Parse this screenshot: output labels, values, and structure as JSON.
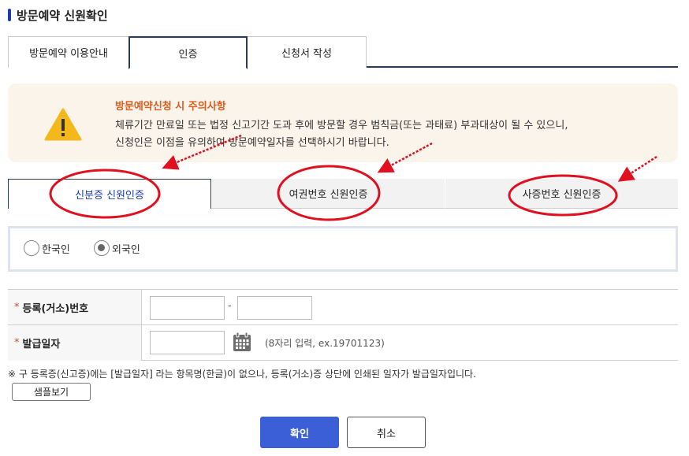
{
  "page": {
    "title": "방문예약 신원확인"
  },
  "tabs": [
    {
      "label": "방문예약 이용안내"
    },
    {
      "label": "인증"
    },
    {
      "label": "신청서 작성"
    }
  ],
  "notice": {
    "title": "방문예약신청 시 주의사항",
    "line1": "체류기간 만료일 또는 법정 신고기간 도과 후에 방문할 경우 범칙금(또는 과태료) 부과대상이 될 수 있으니,",
    "line2": "신청인은 이점을 유의하여 방문예약일자를 선택하시기 바랍니다."
  },
  "auth_tabs": [
    {
      "label": "신분증 신원인증"
    },
    {
      "label": "여권번호 신원인증"
    },
    {
      "label": "사증번호 신원인증"
    }
  ],
  "nationality": {
    "options": [
      "한국인",
      "외국인"
    ],
    "selected": "외국인"
  },
  "form": {
    "reg_label": "등록(거소)번호",
    "reg_dash": "-",
    "issue_label": "발급일자",
    "issue_hint": "(8자리 입력, ex.19701123)",
    "required_mark": "*"
  },
  "note": "※ 구 등록증(신고증)에는 [발급일자] 라는 항목명(한글)이 없으나, 등록(거소)증 상단에 인쇄된 일자가 발급일자입니다.",
  "buttons": {
    "sample": "샘플보기",
    "confirm": "확인",
    "cancel": "취소"
  },
  "colors": {
    "accent": "#3b5fd6",
    "annotation": "#e0101e",
    "warning": "#f5b81c"
  },
  "icons": {
    "warning": "warning-triangle-icon",
    "calendar": "calendar-icon"
  }
}
